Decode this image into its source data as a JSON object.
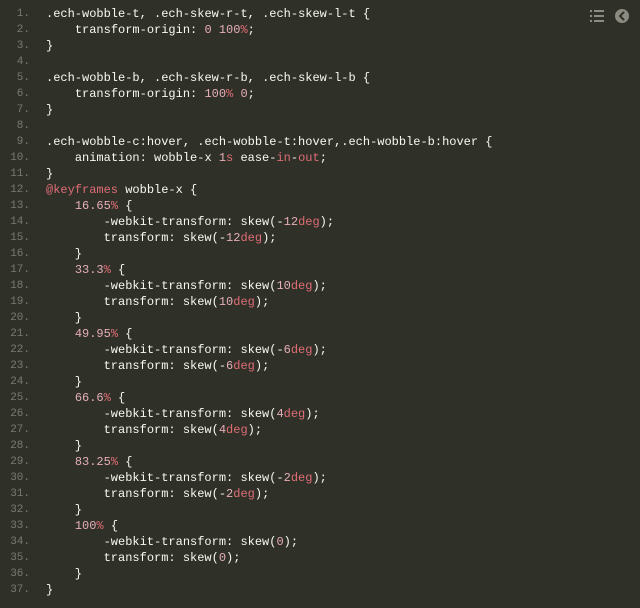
{
  "toolbar": {
    "list_icon": "list-icon",
    "back_icon": "chevron-left-circle-icon"
  },
  "code": {
    "language": "css",
    "lines": [
      [
        [
          ".ech-wobble-t",
          "sel"
        ],
        [
          ", ",
          "punc"
        ],
        [
          ".ech-skew-r-t",
          "sel"
        ],
        [
          ", ",
          "punc"
        ],
        [
          ".ech-skew-l-t",
          "sel"
        ],
        [
          " {",
          "punc"
        ]
      ],
      [
        [
          "    ",
          "punc"
        ],
        [
          "transform-origin",
          "prop"
        ],
        [
          ": ",
          "punc"
        ],
        [
          "0",
          "num"
        ],
        [
          " ",
          "punc"
        ],
        [
          "100",
          "num"
        ],
        [
          "%",
          "unit"
        ],
        [
          ";",
          "punc"
        ]
      ],
      [
        [
          "}",
          "punc"
        ]
      ],
      [],
      [
        [
          ".ech-wobble-b",
          "sel"
        ],
        [
          ", ",
          "punc"
        ],
        [
          ".ech-skew-r-b",
          "sel"
        ],
        [
          ", ",
          "punc"
        ],
        [
          ".ech-skew-l-b",
          "sel"
        ],
        [
          " {",
          "punc"
        ]
      ],
      [
        [
          "    ",
          "punc"
        ],
        [
          "transform-origin",
          "prop"
        ],
        [
          ": ",
          "punc"
        ],
        [
          "100",
          "num"
        ],
        [
          "%",
          "unit"
        ],
        [
          " ",
          "punc"
        ],
        [
          "0",
          "num"
        ],
        [
          ";",
          "punc"
        ]
      ],
      [
        [
          "}",
          "punc"
        ]
      ],
      [],
      [
        [
          ".ech-wobble-c:hover",
          "sel"
        ],
        [
          ", ",
          "punc"
        ],
        [
          ".ech-wobble-t:hover",
          "sel"
        ],
        [
          ",",
          "punc"
        ],
        [
          ".ech-wobble-b:hover",
          "sel"
        ],
        [
          " {",
          "punc"
        ]
      ],
      [
        [
          "    ",
          "punc"
        ],
        [
          "animation",
          "prop"
        ],
        [
          ": ",
          "punc"
        ],
        [
          "wobble-x",
          "fn"
        ],
        [
          " ",
          "punc"
        ],
        [
          "1",
          "num"
        ],
        [
          "s",
          "unit"
        ],
        [
          " ",
          "punc"
        ],
        [
          "ease-",
          "fn"
        ],
        [
          "in",
          "kw"
        ],
        [
          "-",
          "fn"
        ],
        [
          "out",
          "kw"
        ],
        [
          ";",
          "punc"
        ]
      ],
      [
        [
          "}",
          "punc"
        ]
      ],
      [
        [
          "@keyframes",
          "kw"
        ],
        [
          " ",
          "punc"
        ],
        [
          "wobble-x",
          "name"
        ],
        [
          " {",
          "punc"
        ]
      ],
      [
        [
          "    ",
          "punc"
        ],
        [
          "16.65",
          "num"
        ],
        [
          "%",
          "unit"
        ],
        [
          " {",
          "punc"
        ]
      ],
      [
        [
          "        ",
          "punc"
        ],
        [
          "-webkit-transform",
          "prop"
        ],
        [
          ": ",
          "punc"
        ],
        [
          "skew",
          "fn"
        ],
        [
          "(",
          "paren"
        ],
        [
          "-",
          "punc"
        ],
        [
          "12",
          "num"
        ],
        [
          "deg",
          "unit"
        ],
        [
          ")",
          "paren"
        ],
        [
          ";",
          "punc"
        ]
      ],
      [
        [
          "        ",
          "punc"
        ],
        [
          "transform",
          "prop"
        ],
        [
          ": ",
          "punc"
        ],
        [
          "skew",
          "fn"
        ],
        [
          "(",
          "paren"
        ],
        [
          "-",
          "punc"
        ],
        [
          "12",
          "num"
        ],
        [
          "deg",
          "unit"
        ],
        [
          ")",
          "paren"
        ],
        [
          ";",
          "punc"
        ]
      ],
      [
        [
          "    }",
          "punc"
        ]
      ],
      [
        [
          "    ",
          "punc"
        ],
        [
          "33.3",
          "num"
        ],
        [
          "%",
          "unit"
        ],
        [
          " {",
          "punc"
        ]
      ],
      [
        [
          "        ",
          "punc"
        ],
        [
          "-webkit-transform",
          "prop"
        ],
        [
          ": ",
          "punc"
        ],
        [
          "skew",
          "fn"
        ],
        [
          "(",
          "paren"
        ],
        [
          "10",
          "num"
        ],
        [
          "deg",
          "unit"
        ],
        [
          ")",
          "paren"
        ],
        [
          ";",
          "punc"
        ]
      ],
      [
        [
          "        ",
          "punc"
        ],
        [
          "transform",
          "prop"
        ],
        [
          ": ",
          "punc"
        ],
        [
          "skew",
          "fn"
        ],
        [
          "(",
          "paren"
        ],
        [
          "10",
          "num"
        ],
        [
          "deg",
          "unit"
        ],
        [
          ")",
          "paren"
        ],
        [
          ";",
          "punc"
        ]
      ],
      [
        [
          "    }",
          "punc"
        ]
      ],
      [
        [
          "    ",
          "punc"
        ],
        [
          "49.95",
          "num"
        ],
        [
          "%",
          "unit"
        ],
        [
          " {",
          "punc"
        ]
      ],
      [
        [
          "        ",
          "punc"
        ],
        [
          "-webkit-transform",
          "prop"
        ],
        [
          ": ",
          "punc"
        ],
        [
          "skew",
          "fn"
        ],
        [
          "(",
          "paren"
        ],
        [
          "-",
          "punc"
        ],
        [
          "6",
          "num"
        ],
        [
          "deg",
          "unit"
        ],
        [
          ")",
          "paren"
        ],
        [
          ";",
          "punc"
        ]
      ],
      [
        [
          "        ",
          "punc"
        ],
        [
          "transform",
          "prop"
        ],
        [
          ": ",
          "punc"
        ],
        [
          "skew",
          "fn"
        ],
        [
          "(",
          "paren"
        ],
        [
          "-",
          "punc"
        ],
        [
          "6",
          "num"
        ],
        [
          "deg",
          "unit"
        ],
        [
          ")",
          "paren"
        ],
        [
          ";",
          "punc"
        ]
      ],
      [
        [
          "    }",
          "punc"
        ]
      ],
      [
        [
          "    ",
          "punc"
        ],
        [
          "66.6",
          "num"
        ],
        [
          "%",
          "unit"
        ],
        [
          " {",
          "punc"
        ]
      ],
      [
        [
          "        ",
          "punc"
        ],
        [
          "-webkit-transform",
          "prop"
        ],
        [
          ": ",
          "punc"
        ],
        [
          "skew",
          "fn"
        ],
        [
          "(",
          "paren"
        ],
        [
          "4",
          "num"
        ],
        [
          "deg",
          "unit"
        ],
        [
          ")",
          "paren"
        ],
        [
          ";",
          "punc"
        ]
      ],
      [
        [
          "        ",
          "punc"
        ],
        [
          "transform",
          "prop"
        ],
        [
          ": ",
          "punc"
        ],
        [
          "skew",
          "fn"
        ],
        [
          "(",
          "paren"
        ],
        [
          "4",
          "num"
        ],
        [
          "deg",
          "unit"
        ],
        [
          ")",
          "paren"
        ],
        [
          ";",
          "punc"
        ]
      ],
      [
        [
          "    }",
          "punc"
        ]
      ],
      [
        [
          "    ",
          "punc"
        ],
        [
          "83.25",
          "num"
        ],
        [
          "%",
          "unit"
        ],
        [
          " {",
          "punc"
        ]
      ],
      [
        [
          "        ",
          "punc"
        ],
        [
          "-webkit-transform",
          "prop"
        ],
        [
          ": ",
          "punc"
        ],
        [
          "skew",
          "fn"
        ],
        [
          "(",
          "paren"
        ],
        [
          "-",
          "punc"
        ],
        [
          "2",
          "num"
        ],
        [
          "deg",
          "unit"
        ],
        [
          ")",
          "paren"
        ],
        [
          ";",
          "punc"
        ]
      ],
      [
        [
          "        ",
          "punc"
        ],
        [
          "transform",
          "prop"
        ],
        [
          ": ",
          "punc"
        ],
        [
          "skew",
          "fn"
        ],
        [
          "(",
          "paren"
        ],
        [
          "-",
          "punc"
        ],
        [
          "2",
          "num"
        ],
        [
          "deg",
          "unit"
        ],
        [
          ")",
          "paren"
        ],
        [
          ";",
          "punc"
        ]
      ],
      [
        [
          "    }",
          "punc"
        ]
      ],
      [
        [
          "    ",
          "punc"
        ],
        [
          "100",
          "num"
        ],
        [
          "%",
          "unit"
        ],
        [
          " {",
          "punc"
        ]
      ],
      [
        [
          "        ",
          "punc"
        ],
        [
          "-webkit-transform",
          "prop"
        ],
        [
          ": ",
          "punc"
        ],
        [
          "skew",
          "fn"
        ],
        [
          "(",
          "paren"
        ],
        [
          "0",
          "num"
        ],
        [
          ")",
          "paren"
        ],
        [
          ";",
          "punc"
        ]
      ],
      [
        [
          "        ",
          "punc"
        ],
        [
          "transform",
          "prop"
        ],
        [
          ": ",
          "punc"
        ],
        [
          "skew",
          "fn"
        ],
        [
          "(",
          "paren"
        ],
        [
          "0",
          "num"
        ],
        [
          ")",
          "paren"
        ],
        [
          ";",
          "punc"
        ]
      ],
      [
        [
          "    }",
          "punc"
        ]
      ],
      [
        [
          "}",
          "punc"
        ]
      ]
    ]
  }
}
